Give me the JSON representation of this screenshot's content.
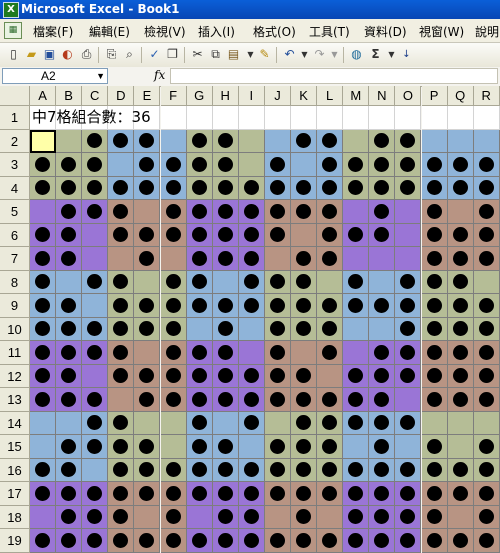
{
  "window": {
    "title": "Microsoft Excel - Book1",
    "app_icon": "excel-icon"
  },
  "menu": {
    "items": [
      "檔案(F)",
      "編輯(E)",
      "檢視(V)",
      "插入(I)",
      "格式(O)",
      "工具(T)",
      "資料(D)",
      "視窗(W)",
      "說明"
    ]
  },
  "toolbar": {
    "buttons": [
      "new",
      "open",
      "save",
      "permission",
      "print-preview",
      "print",
      "spell-check",
      "research",
      "cut",
      "copy",
      "paste",
      "format-painter",
      "undo",
      "redo",
      "insert-hyperlink",
      "autosum",
      "sort-ascending"
    ],
    "sigma_label": "Σ"
  },
  "formula_bar": {
    "name_box": "A2",
    "fx_label": "fx",
    "formula_value": ""
  },
  "sheet": {
    "columns": [
      "A",
      "B",
      "C",
      "D",
      "E",
      "F",
      "G",
      "H",
      "I",
      "J",
      "K",
      "L",
      "M",
      "N",
      "O",
      "P",
      "Q",
      "R"
    ],
    "rows": [
      "1",
      "2",
      "3",
      "4",
      "5",
      "6",
      "7",
      "8",
      "9",
      "10",
      "11",
      "12",
      "13",
      "14",
      "15",
      "16",
      "17",
      "18",
      "19"
    ],
    "row1_text": "中7格組合數：36",
    "selected_cell": "A2",
    "colors": {
      "blue": "#8fb4d9",
      "green": "#b5bd96",
      "purple": "#9a75d6",
      "brown": "#b89483",
      "selected": "#ffffa8"
    },
    "dot_rows": [
      "0011101100110110",
      "1110111101011111",
      "1111111111111111",
      "0111011111110101",
      "1101111111011101",
      "1100101110110001",
      "1011011011101011",
      "1101111111111111",
      "1111110101110011",
      "1111011101010111",
      "1101111111101111",
      "1110111111111101",
      "0011001010111110",
      "0111101101110101",
      "1101111111111111",
      "1111111111111111",
      "0111010110101111",
      "1111111111111111"
    ]
  }
}
